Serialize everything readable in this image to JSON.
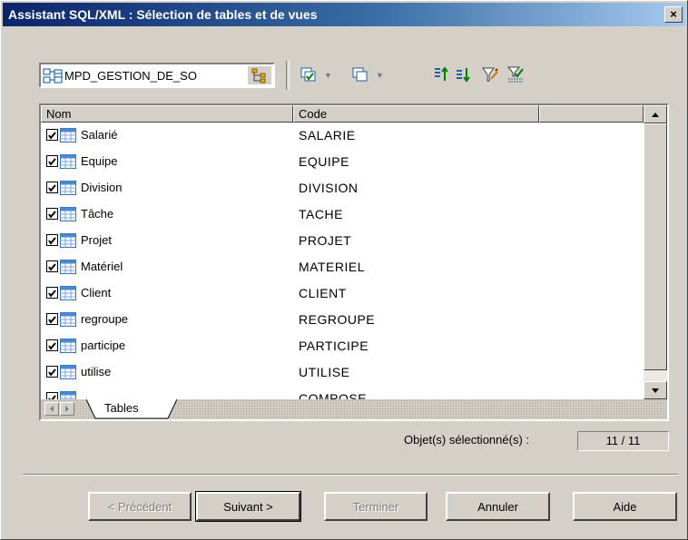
{
  "window": {
    "title": "Assistant SQL/XML : Sélection de tables et de vues",
    "close_label": "×"
  },
  "toolbar": {
    "model_name": "MPD_GESTION_DE_SO",
    "icons": [
      "model-icon",
      "browse-icon",
      "select-all-icon",
      "deselect-all-icon",
      "move-up-icon",
      "move-down-icon",
      "filter-icon",
      "filter-apply-icon"
    ]
  },
  "grid": {
    "columns": [
      "Nom",
      "Code",
      ""
    ],
    "rows": [
      {
        "name": "Salarié",
        "code": "SALARIE",
        "checked": true
      },
      {
        "name": "Equipe",
        "code": "EQUIPE",
        "checked": true
      },
      {
        "name": "Division",
        "code": "DIVISION",
        "checked": true
      },
      {
        "name": "Tâche",
        "code": "TACHE",
        "checked": true
      },
      {
        "name": "Projet",
        "code": "PROJET",
        "checked": true
      },
      {
        "name": "Matériel",
        "code": "MATERIEL",
        "checked": true
      },
      {
        "name": "Client",
        "code": "CLIENT",
        "checked": true
      },
      {
        "name": "regroupe",
        "code": "REGROUPE",
        "checked": true
      },
      {
        "name": "participe",
        "code": "PARTICIPE",
        "checked": true
      },
      {
        "name": "utilise",
        "code": "UTILISE",
        "checked": true
      },
      {
        "name": "",
        "code": "COMPOSE",
        "checked": true
      }
    ],
    "tab_label": "Tables"
  },
  "status": {
    "selected_label": "Objet(s) sélectionné(s) :",
    "selected_value": "11 / 11"
  },
  "buttons": {
    "previous": "< Précédent",
    "next": "Suivant >",
    "finish": "Terminer",
    "cancel": "Annuler",
    "help": "Aide"
  },
  "colors": {
    "title_start": "#0a246a",
    "title_end": "#a6caf0",
    "face": "#d4d0c8"
  }
}
